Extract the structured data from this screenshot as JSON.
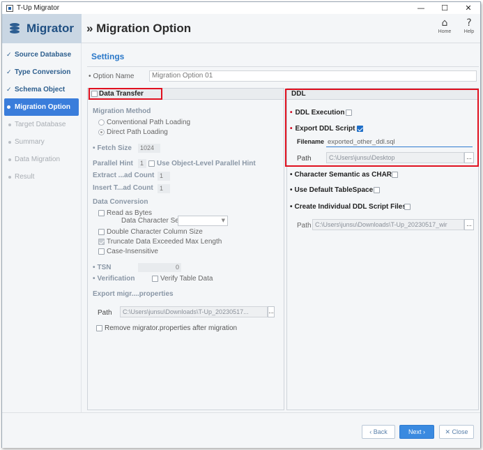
{
  "window": {
    "title": "T-Up Migrator",
    "min_symbol": "—",
    "max_symbol": "☐",
    "close_symbol": "✕"
  },
  "header": {
    "brand": "Migrator",
    "page_title": "» Migration Option",
    "home_label": "Home",
    "help_label": "Help",
    "home_icon": "home-icon",
    "help_icon": "?"
  },
  "sidebar": {
    "items": [
      {
        "label": "Source Database",
        "state": "done"
      },
      {
        "label": "Type Conversion",
        "state": "done"
      },
      {
        "label": "Schema Object",
        "state": "done"
      },
      {
        "label": "Migration Option",
        "state": "active"
      },
      {
        "label": "Target Database",
        "state": "pending"
      },
      {
        "label": "Summary",
        "state": "pending"
      },
      {
        "label": "Data Migration",
        "state": "pending"
      },
      {
        "label": "Result",
        "state": "pending"
      }
    ]
  },
  "settings": {
    "title": "Settings",
    "option_name_label": "Option Name",
    "option_name_value": "Migration Option 01"
  },
  "data_transfer": {
    "title": "Data Transfer",
    "migration_method_label": "Migration Method",
    "conventional": "Conventional Path Loading",
    "direct": "Direct Path Loading",
    "fetch_size_label": "Fetch Size",
    "fetch_size_value": "1024",
    "parallel_hint_label": "Parallel Hint",
    "parallel_hint_value": "1",
    "use_object_level": "Use Object-Level Parallel Hint",
    "extract_label": "Extract ...ad Count",
    "extract_value": "1",
    "insert_label": "Insert T...ad Count",
    "insert_value": "1",
    "data_conversion_label": "Data Conversion",
    "read_as_bytes": "Read as Bytes",
    "data_charset_label": "Data Character Set",
    "double_char": "Double Character Column Size",
    "truncate": "Truncate Data Exceeded Max Length",
    "case_insensitive": "Case-Insensitive",
    "tsn_label": "TSN",
    "tsn_value": "0",
    "verification_label": "Verification",
    "verify_table_data": "Verify Table Data",
    "export_props_label": "Export migr....properties",
    "path_label": "Path",
    "path_value": "C:\\Users\\junsu\\Downloads\\T-Up_20230517...",
    "dots": "...",
    "remove_props": "Remove migrator.properties after migration"
  },
  "ddl": {
    "title": "DDL",
    "ddl_execution": "DDL Execution",
    "export_ddl_script": "Export DDL Script",
    "filename_label": "Filename",
    "filename_value": "exported_other_ddl.sql",
    "path_label": "Path",
    "path_value": "C:\\Users\\junsu\\Desktop",
    "dots": "...",
    "char_semantic": "Character Semantic as CHAR",
    "use_default_ts": "Use Default TableSpace",
    "create_individual": "Create Individual DDL Script Files",
    "indiv_path_label": "Path",
    "indiv_path_value": "C:\\Users\\junsu\\Downloads\\T-Up_20230517_wir",
    "indiv_dots": "..."
  },
  "footer": {
    "back": "‹ Back",
    "next": "Next ›",
    "close": "✕ Close"
  },
  "colors": {
    "accent": "#3a7ddb",
    "highlight_border": "#e0101f",
    "settings_title": "#2a78c9"
  }
}
